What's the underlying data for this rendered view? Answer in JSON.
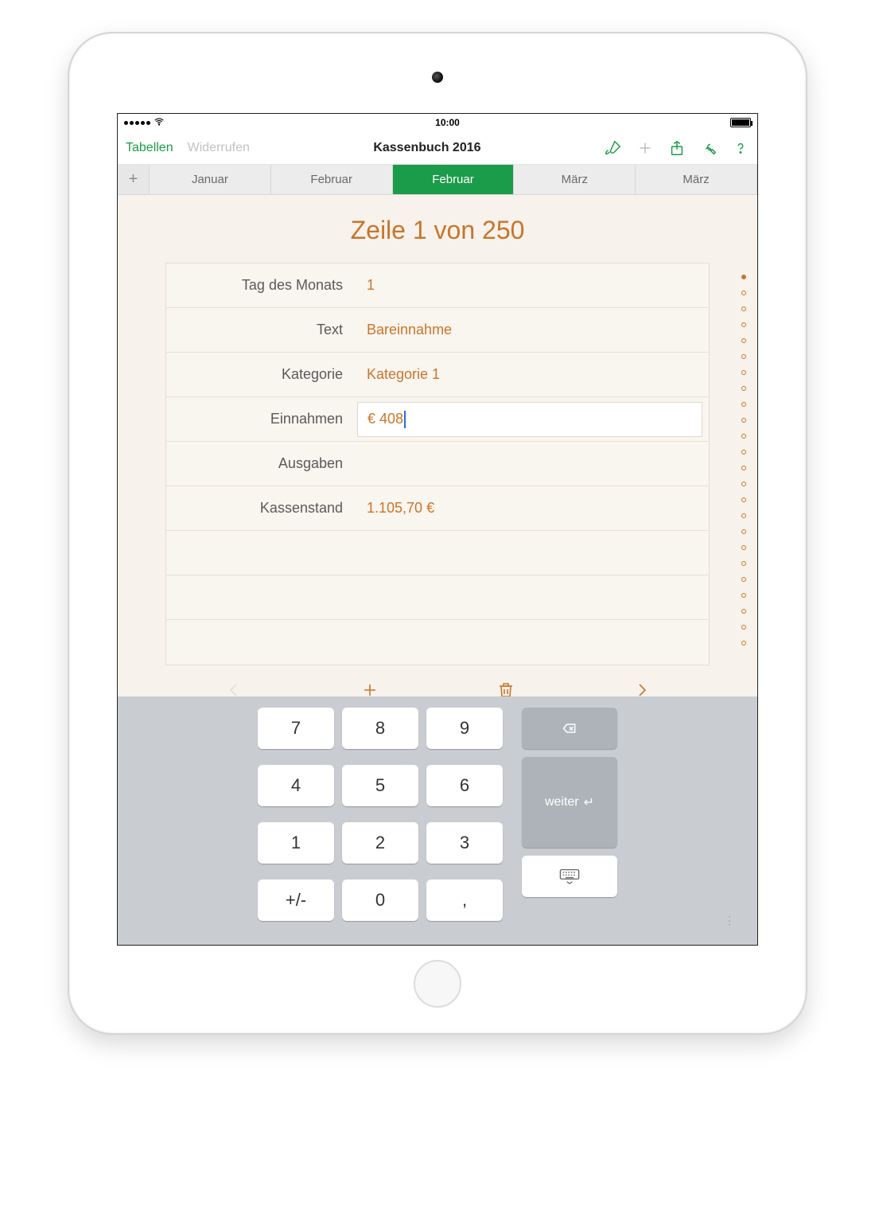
{
  "status": {
    "time": "10:00"
  },
  "toolbar": {
    "back_label": "Tabellen",
    "undo_label": "Widerrufen",
    "title": "Kassenbuch 2016"
  },
  "tabs": {
    "items": [
      {
        "label": "Januar",
        "active": false
      },
      {
        "label": "Februar",
        "active": false
      },
      {
        "label": "Februar",
        "active": true
      },
      {
        "label": "März",
        "active": false
      },
      {
        "label": "März",
        "active": false
      }
    ]
  },
  "page": {
    "title": "Zeile 1 von 250"
  },
  "form": {
    "rows": [
      {
        "label": "Tag des Monats",
        "value": "1"
      },
      {
        "label": "Text",
        "value": "Bareinnahme"
      },
      {
        "label": "Kategorie",
        "value": "Kategorie 1"
      },
      {
        "label": "Einnahmen",
        "value": "€ 408",
        "editing": true
      },
      {
        "label": "Ausgaben",
        "value": ""
      },
      {
        "label": "Kassenstand",
        "value": "1.105,70 €"
      }
    ]
  },
  "keypad": {
    "k7": "7",
    "k8": "8",
    "k9": "9",
    "k4": "4",
    "k5": "5",
    "k6": "6",
    "k1": "1",
    "k2": "2",
    "k3": "3",
    "pm": "+/-",
    "k0": "0",
    "comma": ",",
    "next_label": "weiter"
  }
}
